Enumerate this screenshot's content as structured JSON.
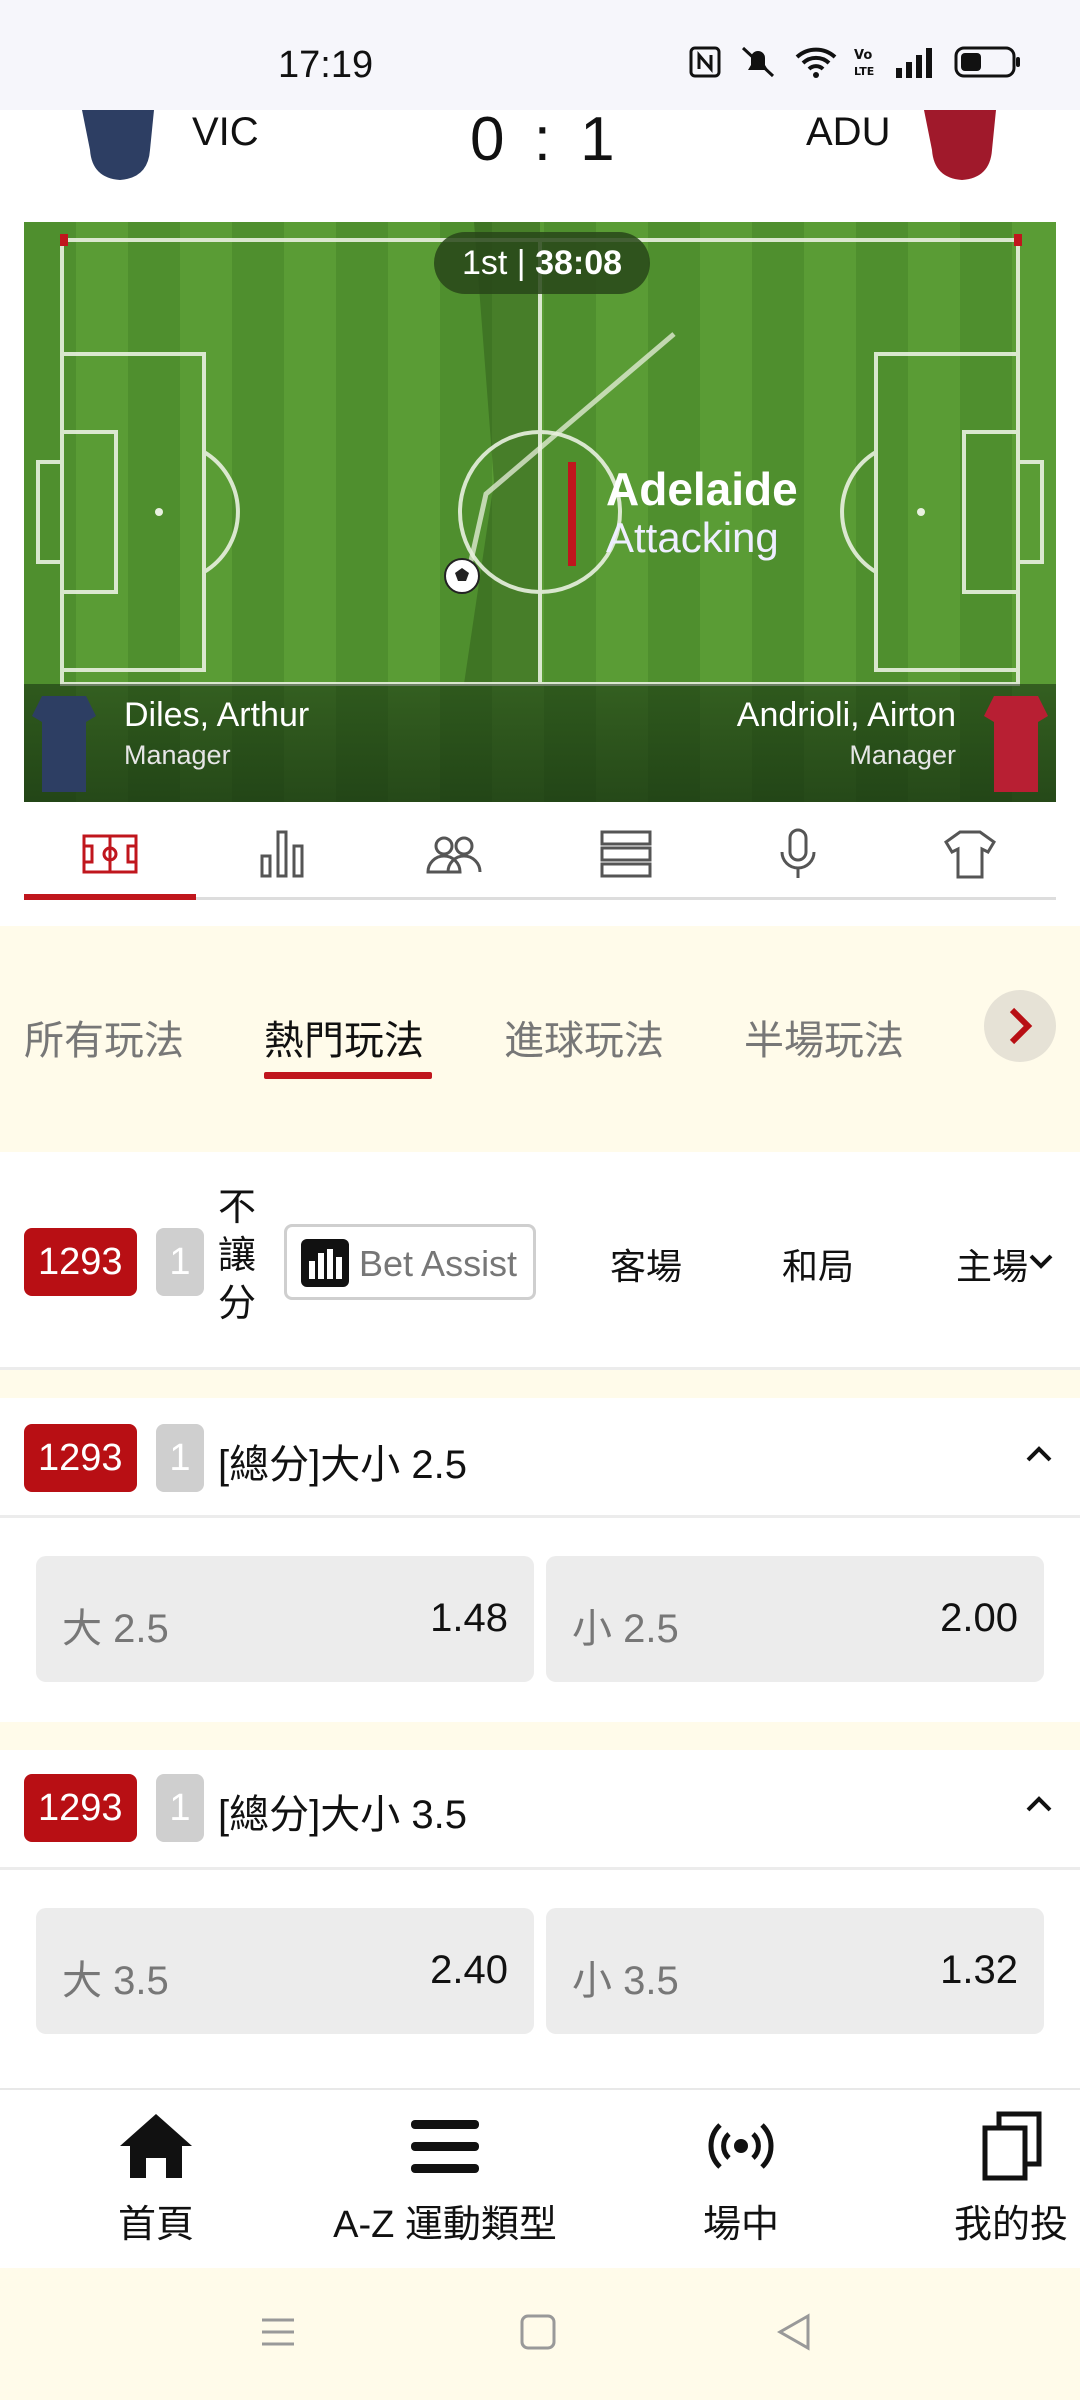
{
  "status_bar": {
    "time": "17:19"
  },
  "match": {
    "home_code": "VIC",
    "away_code": "ADU",
    "score": "0 : 1"
  },
  "tracker": {
    "period": "1st",
    "clock": "38:08",
    "team": "Adelaide",
    "state": "Attacking",
    "home_manager": {
      "name": "Diles, Arthur",
      "role": "Manager"
    },
    "away_manager": {
      "name": "Andrioli, Airton",
      "role": "Manager"
    }
  },
  "icon_tabs": [
    "pitch-icon",
    "stats-icon",
    "lineup-icon",
    "list-icon",
    "microphone-icon",
    "shirt-icon"
  ],
  "market_tabs": [
    "所有玩法",
    "熱門玩法",
    "進球玩法",
    "半場玩法"
  ],
  "market_header": {
    "match_id": "1293",
    "count": "1",
    "type_label": "不讓分",
    "bet_assist": "Bet Assist",
    "cols": [
      "客場",
      "和局",
      "主場"
    ]
  },
  "markets": [
    {
      "id": "1293",
      "count": "1",
      "title": "[總分]大小 2.5",
      "odds": [
        {
          "label": "大 2.5",
          "value": "1.48"
        },
        {
          "label": "小 2.5",
          "value": "2.00"
        }
      ]
    },
    {
      "id": "1293",
      "count": "1",
      "title": "[總分]大小 3.5",
      "odds": [
        {
          "label": "大 3.5",
          "value": "2.40"
        },
        {
          "label": "小 3.5",
          "value": "1.32"
        }
      ]
    }
  ],
  "bottom_nav": [
    {
      "label": "首頁",
      "icon": "home-icon"
    },
    {
      "label": "A-Z 運動類型",
      "icon": "menu-icon"
    },
    {
      "label": "場中",
      "icon": "live-icon"
    },
    {
      "label": "我的投",
      "icon": "copy-icon"
    }
  ],
  "colors": {
    "accent": "#c0161d",
    "badge": "#b80f14",
    "pitch": "#5a9c35"
  }
}
